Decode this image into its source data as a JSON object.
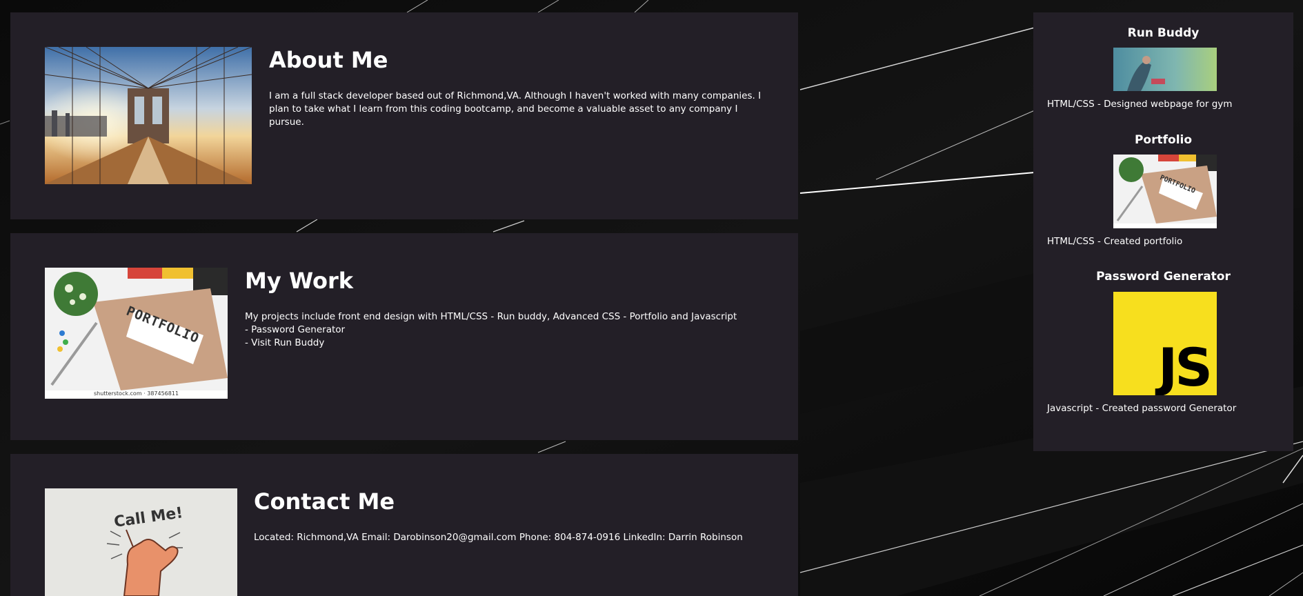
{
  "about": {
    "title": "About Me",
    "text": "I am a full stack developer based out of Richmond,VA. Although I haven't worked with many companies. I plan to take what I learn from this coding bootcamp, and become a valuable asset to any company I pursue.",
    "image_icon": "bridge-photo"
  },
  "work": {
    "title": "My Work",
    "text_line1": "My projects include front end design with HTML/CSS - Run buddy, Advanced CSS - Portfolio and Javascript - Password Generator",
    "text_line2": "- Visit Run Buddy",
    "image_icon": "portfolio-notebook-photo",
    "image_caption": "shutterstock.com · 387456811"
  },
  "contact": {
    "title": "Contact Me",
    "text": "Located: Richmond,VA Email: Darobinson20@gmail.com Phone: 804-874-0916 LinkedIn: Darrin Robinson",
    "image_icon": "call-me-hand-photo",
    "image_text": "Call Me!"
  },
  "projects": [
    {
      "title": "Run Buddy",
      "description": "HTML/CSS - Designed webpage for gym",
      "thumbnail_icon": "runner-thumbnail"
    },
    {
      "title": "Portfolio",
      "description": "HTML/CSS - Created portfolio",
      "thumbnail_icon": "portfolio-thumbnail",
      "thumbnail_text": "PORTFOLIO"
    },
    {
      "title": "Password Generator",
      "description": "Javascript - Created password Generator",
      "thumbnail_icon": "js-logo-thumbnail",
      "thumbnail_text": "JS"
    }
  ],
  "colors": {
    "card_background": "#231f27",
    "page_background": "#050505",
    "js_yellow": "#f7df1e"
  }
}
